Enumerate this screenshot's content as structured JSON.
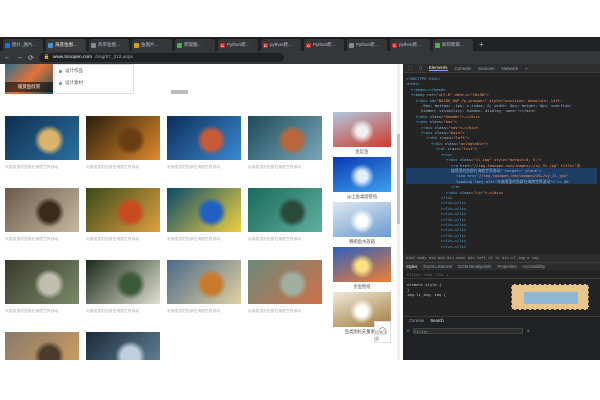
{
  "browser": {
    "tabs": [
      {
        "title": "图片_图片…",
        "favicon_color": "#1a73e8",
        "favicon_glyph": ""
      },
      {
        "title": "海底鱼图…",
        "favicon_color": "#4a90d9",
        "favicon_glyph": "",
        "active": true
      },
      {
        "title": "热带鱼图…",
        "favicon_color": "#8a8a8a",
        "favicon_glyph": ""
      },
      {
        "title": "鱼图片…",
        "favicon_color": "#d4a017",
        "favicon_glyph": ""
      },
      {
        "title": "爬取图…",
        "favicon_color": "#4caf50",
        "favicon_glyph": ""
      },
      {
        "title": "Python爬…",
        "favicon_color": "#c62828",
        "favicon_glyph": "C"
      },
      {
        "title": "python爬…",
        "favicon_color": "#c62828",
        "favicon_glyph": "C"
      },
      {
        "title": "Python爬…",
        "favicon_color": "#c62828",
        "favicon_glyph": "C"
      },
      {
        "title": "Python爬…",
        "favicon_color": "#8a8a8a",
        "favicon_glyph": ""
      },
      {
        "title": "python爬…",
        "favicon_color": "#c62828",
        "favicon_glyph": "C"
      },
      {
        "title": "如何爬取…",
        "favicon_color": "#4caf50",
        "favicon_glyph": ""
      }
    ],
    "new_tab": "+",
    "url_host": "www.tooopen.com",
    "url_path": "/img/87_312.aspx"
  },
  "page": {
    "dropdown_items": [
      "设计作品",
      "设计素材"
    ],
    "top_thumb_label": "观赏鱼欣赏",
    "grid_caption": "水族馆里的鱼群在海底世界游动",
    "grid": [
      {
        "c1": "#0f2f4f",
        "c2": "#2a6fa0",
        "c3": "#d9b46a"
      },
      {
        "c1": "#2a1d0e",
        "c2": "#e08a2a",
        "c3": "#6a3d12"
      },
      {
        "c1": "#0c2d5a",
        "c2": "#3a8ad0",
        "c3": "#c85a3a"
      },
      {
        "c1": "#1e4a5a",
        "c2": "#7aa8b8",
        "c3": "#b8673a"
      },
      {
        "c1": "#6a5a4a",
        "c2": "#c8b8a0",
        "c3": "#3a2a1a"
      },
      {
        "c1": "#3a4a1a",
        "c2": "#e0a040",
        "c3": "#c84a20"
      },
      {
        "c1": "#0a4a6a",
        "c2": "#f0d040",
        "c3": "#2060c0"
      },
      {
        "c1": "#1a6a5a",
        "c2": "#60b0a0",
        "c3": "#2a4a3a"
      },
      {
        "c1": "#3a3a2a",
        "c2": "#7a8a6a",
        "c3": "#c0c0b0"
      },
      {
        "c1": "#1a2a1a",
        "c2": "#e0e0d0",
        "c3": "#3a5a3a"
      },
      {
        "c1": "#4a6a8a",
        "c2": "#e0d0a0",
        "c3": "#c87a2a"
      },
      {
        "c1": "#6a8a7a",
        "c2": "#d0704a",
        "c3": "#a0b0a0"
      },
      {
        "c1": "#8a7a6a",
        "c2": "#d0a060",
        "c3": "#4a3a2a"
      },
      {
        "c1": "#1a2a3a",
        "c2": "#6a8aa0",
        "c3": "#c0d0e0"
      }
    ],
    "right_col": [
      {
        "caption": "鱼缸鱼",
        "c1": "#b0c8e0",
        "c2": "#d03a2a",
        "c3": "#f0f0f0"
      },
      {
        "caption": "xp上鱼桌面壁纸",
        "c1": "#0a3ab0",
        "c2": "#40a0f0",
        "c3": "#e0f0ff"
      },
      {
        "caption": "鹦鹉鱼水族箱",
        "c1": "#e0e8f0",
        "c2": "#6a9ad0",
        "c3": "#ffffff"
      },
      {
        "caption": "金鱼壁纸",
        "c1": "#2a60c0",
        "c2": "#f08030",
        "c3": "#ffe080"
      },
      {
        "caption": "鱼类图标矢量素材",
        "c1": "#f0ead8",
        "c2": "#a07a40",
        "c3": "#ffffff"
      }
    ],
    "top_button_label": "回到顶部"
  },
  "devtools": {
    "tabs": [
      "Elements",
      "Console",
      "Sources",
      "Network",
      "»"
    ],
    "active_tab": "Elements",
    "dom_lines": [
      {
        "indent": 0,
        "tag": "<!DOCTYPE html>",
        "attr": "",
        "val": ""
      },
      {
        "indent": 0,
        "tag": "<html>",
        "attr": "",
        "val": ""
      },
      {
        "indent": 1,
        "tag": "▸<head>…</head>",
        "attr": "",
        "val": ""
      },
      {
        "indent": 1,
        "tag": "▾<body",
        "attr": " ref=",
        "val": "\"utf-8\" data-v=\"10c98\">"
      },
      {
        "indent": 2,
        "tag": "▸<div",
        "attr": " id=",
        "val": "\"BAIDU_DUP_fp_wrapper\" style=\"position: absolute; left:"
      },
      {
        "indent": 3,
        "tag": "",
        "attr": "-9px; bottom: -1px; z-index: 0; width: 0px; height: 0px; overflow:",
        "val": ""
      },
      {
        "indent": 3,
        "tag": "",
        "attr": "hidden; visibility: hidden; display: none;\"></div>",
        "val": ""
      },
      {
        "indent": 2,
        "tag": "▸<div",
        "attr": " class=",
        "val": "\"header\">…</div>"
      },
      {
        "indent": 2,
        "tag": "▾<div",
        "attr": " class=",
        "val": "\"box\">"
      },
      {
        "indent": 3,
        "tag": "▸<div",
        "attr": " class=",
        "val": "\"nav\">…</div>"
      },
      {
        "indent": 3,
        "tag": "▾<div",
        "attr": " class=",
        "val": "\"main\">"
      },
      {
        "indent": 4,
        "tag": "▾<div",
        "attr": " class=",
        "val": "\"left\">"
      },
      {
        "indent": 5,
        "tag": "▾<div",
        "attr": " class=",
        "val": "\"aclogtable\">"
      },
      {
        "indent": 6,
        "tag": "▾<ul",
        "attr": " class=",
        "val": "\"list\">"
      },
      {
        "indent": 7,
        "tag": "▾<li>",
        "attr": "",
        "val": ""
      },
      {
        "indent": 8,
        "tag": "▾<div",
        "attr": " class=",
        "val": "\"cl_img\" style=\"margin:0; 5;\">"
      },
      {
        "indent": 9,
        "tag": "▸<a",
        "attr": " href=",
        "val": "\"//img.tooopen.com/images/…/sy_31.jpg\" title=\"水"
      },
      {
        "indent": 9,
        "tag": "",
        "attr": "族馆里的鱼群在海底世界游动\" target=\"_blank\">",
        "val": "",
        "sel": true
      },
      {
        "indent": 10,
        "tag": "<img",
        "attr": " src=",
        "val": "\"//img.tooopen.com/images/20…/sy_31.jpg\"",
        "sel": true
      },
      {
        "indent": 10,
        "tag": "",
        "attr": "loading lazy alt=\"水族馆里的鱼群在海底世界游动\"> == $0",
        "val": "",
        "sel": true
      },
      {
        "indent": 9,
        "tag": "</a>",
        "attr": "",
        "val": ""
      },
      {
        "indent": 8,
        "tag": "▸<div",
        "attr": " class=",
        "val": "\"tit\">…</div>"
      },
      {
        "indent": 7,
        "tag": "</li>",
        "attr": "",
        "val": ""
      },
      {
        "indent": 7,
        "tag": "▸<li>…</li>",
        "attr": "",
        "val": ""
      },
      {
        "indent": 7,
        "tag": "▸<li>…</li>",
        "attr": "",
        "val": ""
      },
      {
        "indent": 7,
        "tag": "▸<li>…</li>",
        "attr": "",
        "val": ""
      },
      {
        "indent": 7,
        "tag": "▸<li>…</li>",
        "attr": "",
        "val": ""
      },
      {
        "indent": 7,
        "tag": "▸<li>…</li>",
        "attr": "",
        "val": ""
      },
      {
        "indent": 7,
        "tag": "▸<li>…</li>",
        "attr": "",
        "val": ""
      },
      {
        "indent": 7,
        "tag": "▸<li>…</li>",
        "attr": "",
        "val": ""
      },
      {
        "indent": 7,
        "tag": "▸<li>…</li>",
        "attr": "",
        "val": ""
      },
      {
        "indent": 7,
        "tag": "▸<li>…</li>",
        "attr": "",
        "val": ""
      }
    ],
    "breadcrumb": "html  body  div.box  div.main  div.left  ul  li  div.cl_img  a  img",
    "styles_tabs": [
      "Styles",
      "Event Listeners",
      "DOM Breakpoints",
      "Properties",
      "Accessibility"
    ],
    "styles_active": "Styles",
    "filter_text": "Filter        :hov  .cls  +",
    "style_rules": [
      "element.style {",
      "}",
      "img.li_img, img {"
    ],
    "console_tabs": [
      "Console",
      "Search"
    ],
    "console_active": "Search",
    "console_filter_placeholder": "Filter"
  }
}
